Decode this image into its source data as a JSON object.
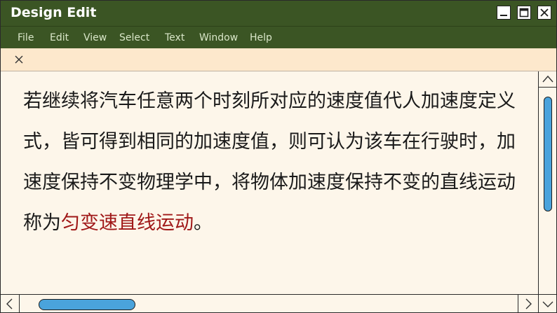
{
  "window": {
    "title": "Design Edit"
  },
  "menu": {
    "items": [
      "File",
      "Edit",
      "View",
      "Select",
      "Text",
      "Window",
      "Help"
    ]
  },
  "document": {
    "text_before": "若继续将汽车任意两个时刻所对应的速度值代人加速度定义式，皆可得到相同的加速度值，则可认为该车在行驶时，加速度保持不变物理学中，将物体加速度保持不变的直线运动称为",
    "highlight": "匀变速直线运动",
    "text_after": "。"
  },
  "colors": {
    "titlebar": "#3b5524",
    "tabbar": "#fde8cc",
    "content_bg": "#fdf6ea",
    "highlight_text": "#a01818",
    "scroll_thumb": "#4aa3dc"
  },
  "icons": {
    "minimize": "minimize-icon",
    "maximize": "maximize-icon",
    "close": "close-icon",
    "tab_close": "close-icon",
    "scroll_up": "chevron-up-icon",
    "scroll_down": "chevron-down-icon",
    "scroll_left": "chevron-left-icon",
    "scroll_right": "chevron-right-icon"
  }
}
